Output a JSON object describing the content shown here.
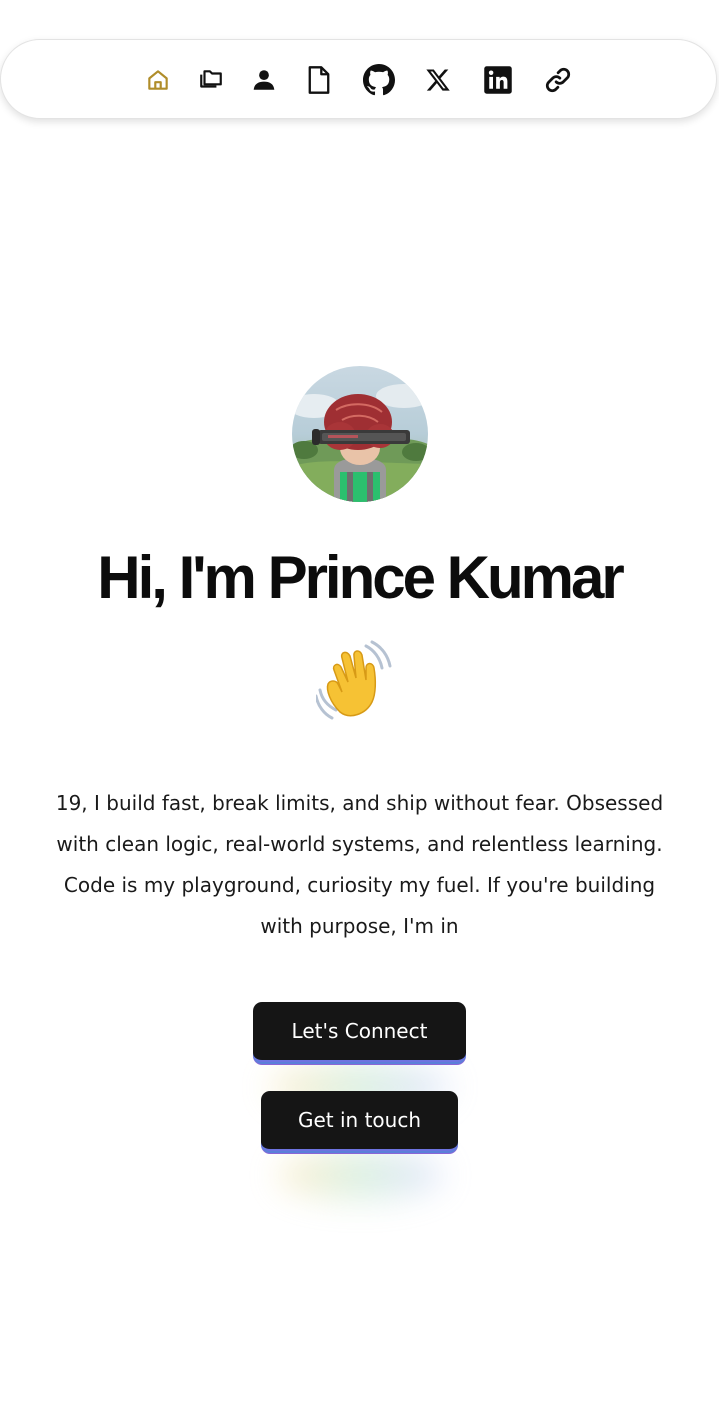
{
  "nav": {
    "items": [
      {
        "name": "home",
        "icon": "home-icon",
        "active": true
      },
      {
        "name": "projects",
        "icon": "folders-icon"
      },
      {
        "name": "about",
        "icon": "user-icon"
      },
      {
        "name": "resume",
        "icon": "file-icon"
      },
      {
        "name": "github",
        "icon": "github-icon"
      },
      {
        "name": "x",
        "icon": "x-icon"
      },
      {
        "name": "linkedin",
        "icon": "linkedin-icon"
      },
      {
        "name": "links",
        "icon": "link-icon"
      }
    ],
    "active_color": "#b08d2a"
  },
  "hero": {
    "title": "Hi, I'm Prince Kumar",
    "wave_emoji": "👋",
    "bio": "19, I build fast, break limits, and ship without fear. Obsessed with clean logic, real-world systems, and relentless learning. Code is my playground, curiosity my fuel. If you're building with purpose, I'm in"
  },
  "buttons": {
    "connect_label": "Let's Connect",
    "touch_label": "Get in touch"
  }
}
